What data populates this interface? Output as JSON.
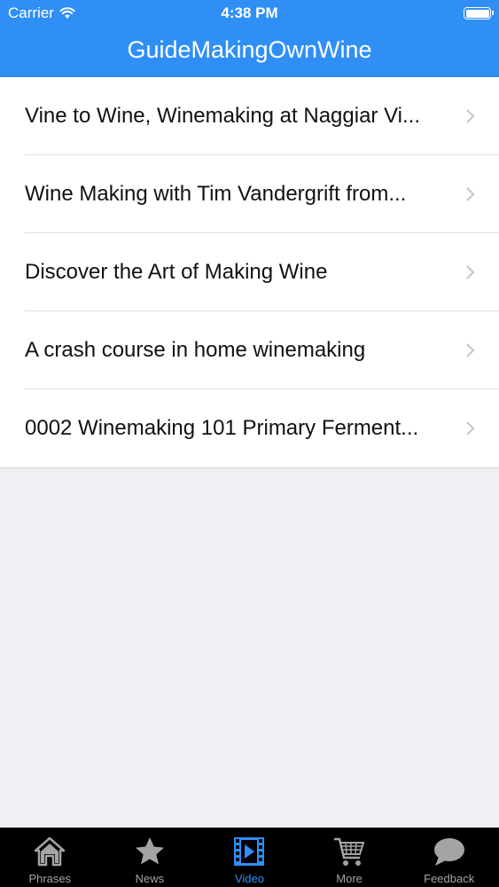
{
  "status_bar": {
    "carrier": "Carrier",
    "time": "4:38 PM"
  },
  "nav": {
    "title": "GuideMakingOwnWine"
  },
  "videos": [
    {
      "label": "Vine to Wine, Winemaking at Naggiar Vi..."
    },
    {
      "label": "Wine Making with Tim Vandergrift from..."
    },
    {
      "label": "Discover the Art of Making Wine"
    },
    {
      "label": "A crash course in home winemaking"
    },
    {
      "label": "0002 Winemaking 101 Primary Ferment..."
    }
  ],
  "tabs": [
    {
      "label": "Phrases",
      "icon": "home-icon",
      "active": false
    },
    {
      "label": "News",
      "icon": "star-icon",
      "active": false
    },
    {
      "label": "Video",
      "icon": "film-icon",
      "active": true
    },
    {
      "label": "More",
      "icon": "cart-icon",
      "active": false
    },
    {
      "label": "Feedback",
      "icon": "speech-bubble-icon",
      "active": false
    }
  ],
  "colors": {
    "accent": "#2f8ff5",
    "tab_inactive": "#a4a4a4",
    "background": "#efeff4"
  }
}
